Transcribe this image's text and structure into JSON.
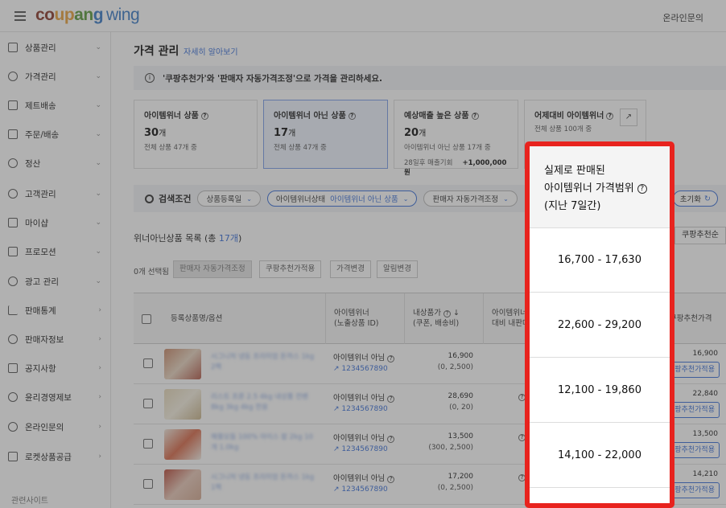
{
  "header": {
    "logo_parts": [
      "co",
      "up",
      "an",
      "g"
    ],
    "logo_wing": "wing",
    "inquiry": "온라인문의"
  },
  "sidebar": {
    "items": [
      {
        "label": "상품관리",
        "icon": "box-icon"
      },
      {
        "label": "가격관리",
        "icon": "medal-icon"
      },
      {
        "label": "제트배송",
        "icon": "rocket-icon"
      },
      {
        "label": "주문/배송",
        "icon": "truck-icon"
      },
      {
        "label": "정산",
        "icon": "won-icon"
      },
      {
        "label": "고객관리",
        "icon": "smile-icon"
      },
      {
        "label": "마이샵",
        "icon": "shop-icon"
      },
      {
        "label": "프로모션",
        "icon": "promotion-icon"
      },
      {
        "label": "광고 관리",
        "icon": "ad-icon"
      },
      {
        "label": "판매통계",
        "icon": "bar-chart-icon"
      },
      {
        "label": "판매자정보",
        "icon": "person-icon"
      },
      {
        "label": "공지사항",
        "icon": "megaphone-icon"
      },
      {
        "label": "윤리경영제보",
        "icon": "ethics-icon"
      },
      {
        "label": "온라인문의",
        "icon": "headset-icon"
      },
      {
        "label": "로켓상품공급",
        "icon": "cart-icon"
      }
    ],
    "footer": "관련사이트"
  },
  "page": {
    "title": "가격 관리",
    "learn_more": "자세히 알아보기",
    "info": "'쿠팡추천가'와 '판매자 자동가격조정'으로 가격을 관리하세요."
  },
  "cards": [
    {
      "title": "아이템위너 상품",
      "value": "30",
      "unit": "개",
      "sub": "전체 상품 47개 중"
    },
    {
      "title": "아이템위너 아닌 상품",
      "value": "17",
      "unit": "개",
      "sub": "전체 상품 47개 중"
    },
    {
      "title": "예상매출 높은 상품",
      "value": "20",
      "unit": "개",
      "sub": "아이템위너 아닌 상품 17개 중",
      "extra_label": "28일후 매출기회",
      "extra_value": "+1,000,000원"
    },
    {
      "title": "어제대비 아이템위너",
      "sub": "전체 상품 100개 중"
    }
  ],
  "filter": {
    "label": "검색조건",
    "chips": [
      {
        "label": "상품등록일",
        "accent": ""
      },
      {
        "label": "아이템위너상태",
        "accent": "아이템위너 아닌 상품"
      },
      {
        "label": "판매자 자동가격조정",
        "accent": ""
      }
    ],
    "reset": "초기화"
  },
  "list": {
    "title_prefix": "위너아닌상품 목록 (총 ",
    "count": "17개",
    "title_suffix": ")",
    "sort": "쿠팡추천순",
    "selected": "0개 선택됨",
    "actions": [
      "판매자 자동가격조정",
      "쿠팡추천가적용",
      "가격변경",
      "알림변경"
    ]
  },
  "table": {
    "headers": {
      "product": "등록상품명/옵션",
      "winner_line1": "아이템위너",
      "winner_line2": "(노출상품 ID)",
      "price_line1": "내상품가",
      "price_line2": "(쿠폰, 배송비)",
      "compare_line1": "아이템위너",
      "compare_line2": "대비 내판매",
      "recommend": "쿠팡추천가격"
    },
    "rows": [
      {
        "name": "시그니처 냉동 프리미엄 돈까스 1kg 2팩",
        "winner": "아이템위너 아님",
        "id": "1234567890",
        "price": "16,900",
        "price_sub": "(0, 2,500)",
        "rec": "16,900",
        "rec_btn": "쿠팡추천가적용"
      },
      {
        "name": "리스트 프론 2.5 4kg 내상품 컨벤 8kg 3kg 4kg 전용",
        "winner": "아이템위너 아님",
        "id": "1234567890",
        "price": "28,690",
        "price_sub": "(0, 20)",
        "rec": "22,840",
        "rec_btn": "쿠팡추천가적용"
      },
      {
        "name": "해물모듬 100% 아이스 팝 2kg 10개 1.0kg",
        "winner": "아이템위너 아님",
        "id": "1234567890",
        "price": "13,500",
        "price_sub": "(300, 2,500)",
        "rec": "13,500",
        "rec_btn": "쿠팡추천가적용"
      },
      {
        "name": "시그니처 냉동 프리미엄 돈까스 1kg 1팩",
        "winner": "아이템위너 아님",
        "id": "1234567890",
        "price": "17,200",
        "price_sub": "(0, 2,500)",
        "rec": "14,210",
        "rec_btn": "쿠팡추천가적용"
      }
    ]
  },
  "popup": {
    "title_lines": [
      "실제로 판매된",
      "아이템위너 가격범위",
      "(지난 7일간)"
    ],
    "ranges": [
      "16,700 - 17,630",
      "22,600 - 29,200",
      "12,100 - 19,860",
      "14,100 - 22,000"
    ]
  },
  "colors": {
    "accent": "#3a6fd8",
    "highlight_border": "#e8231e"
  }
}
